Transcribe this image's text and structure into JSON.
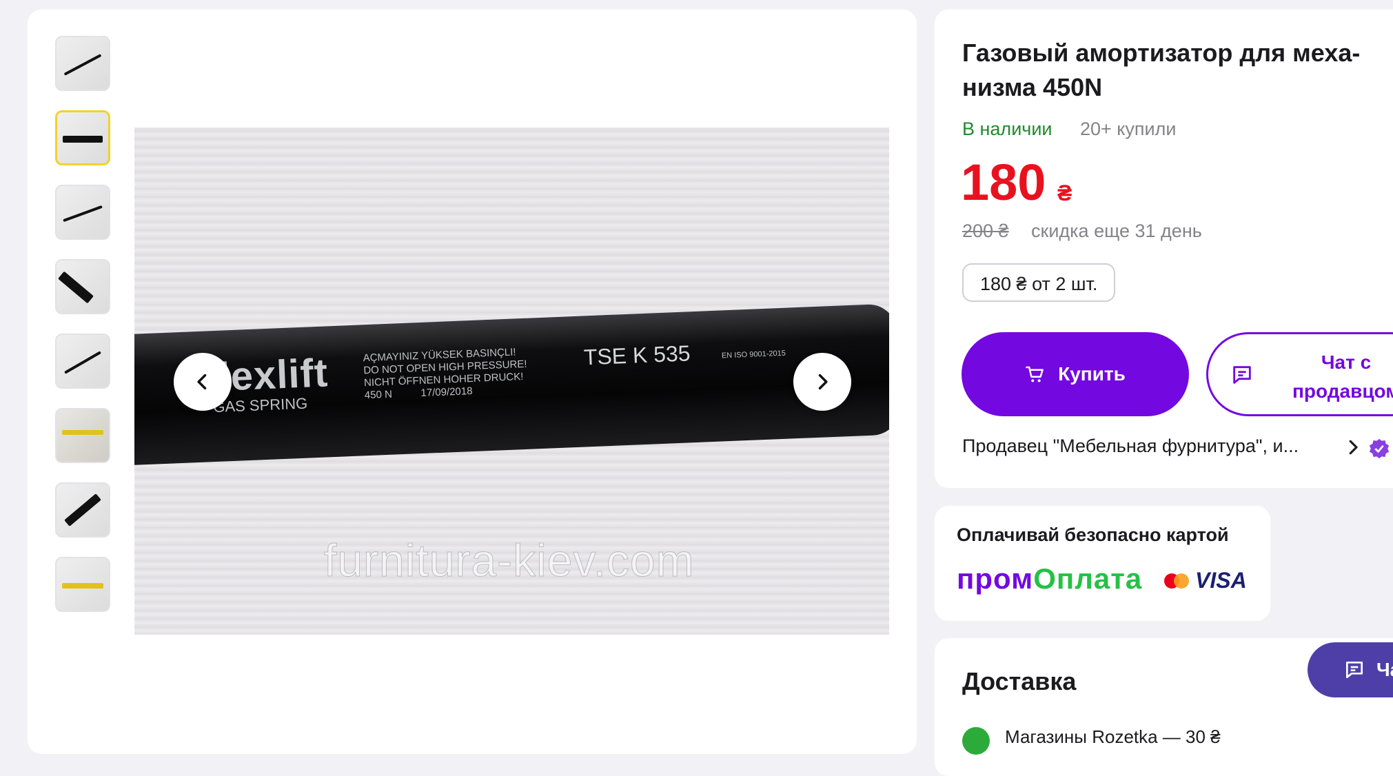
{
  "gallery": {
    "thumbnails": [
      {
        "label": "photo-1"
      },
      {
        "label": "photo-2"
      },
      {
        "label": "photo-3"
      },
      {
        "label": "photo-4"
      },
      {
        "label": "photo-5"
      },
      {
        "label": "photo-6"
      },
      {
        "label": "photo-7"
      },
      {
        "label": "photo-8"
      }
    ],
    "active_index": 1,
    "photo": {
      "brand_text": "lexlift",
      "brand_sub": "GAS SPRING",
      "warning_lines": [
        "AÇMAYINIZ YÜKSEK BASINÇLI!",
        "DO NOT OPEN HIGH PRESSURE!",
        "NICHT ÖFFNEN HOHER DRUCK!"
      ],
      "force": "450 N",
      "date": "17/09/2018",
      "model": "TSE K 535",
      "cert": "EN ISO 9001-2015",
      "watermark": "furnitura-kiev.com"
    },
    "prev_icon": "chevron-left-icon",
    "next_icon": "chevron-right-icon"
  },
  "product": {
    "title": "Газовый амортизатор для меха­низма 450N",
    "stock": "В наличии",
    "bought": "20+ купили",
    "price": "180",
    "currency": "₴",
    "old_price": "200 ₴",
    "discount": "скидка еще 31 день",
    "bulk_price": "180 ₴ от 2 шт.",
    "buy_label": "Купить",
    "chat_label": "Чат с продавцом",
    "seller": "Продавец \"Мебельная фурнитура\", и..."
  },
  "payment": {
    "title": "Оплачивай безопасно картой",
    "prom_part1": "пром",
    "prom_part2": "Оплата",
    "visa": "VISA"
  },
  "delivery": {
    "title": "Доставка",
    "first_item": "Магазины Rozetka — 30 ₴"
  },
  "floating_chat": {
    "label": "Ча"
  },
  "colors": {
    "accent": "#7408e0",
    "price": "#e8121f",
    "in_stock": "#1f8a2c",
    "muted": "#838388",
    "page_bg": "#f2f2f6"
  }
}
